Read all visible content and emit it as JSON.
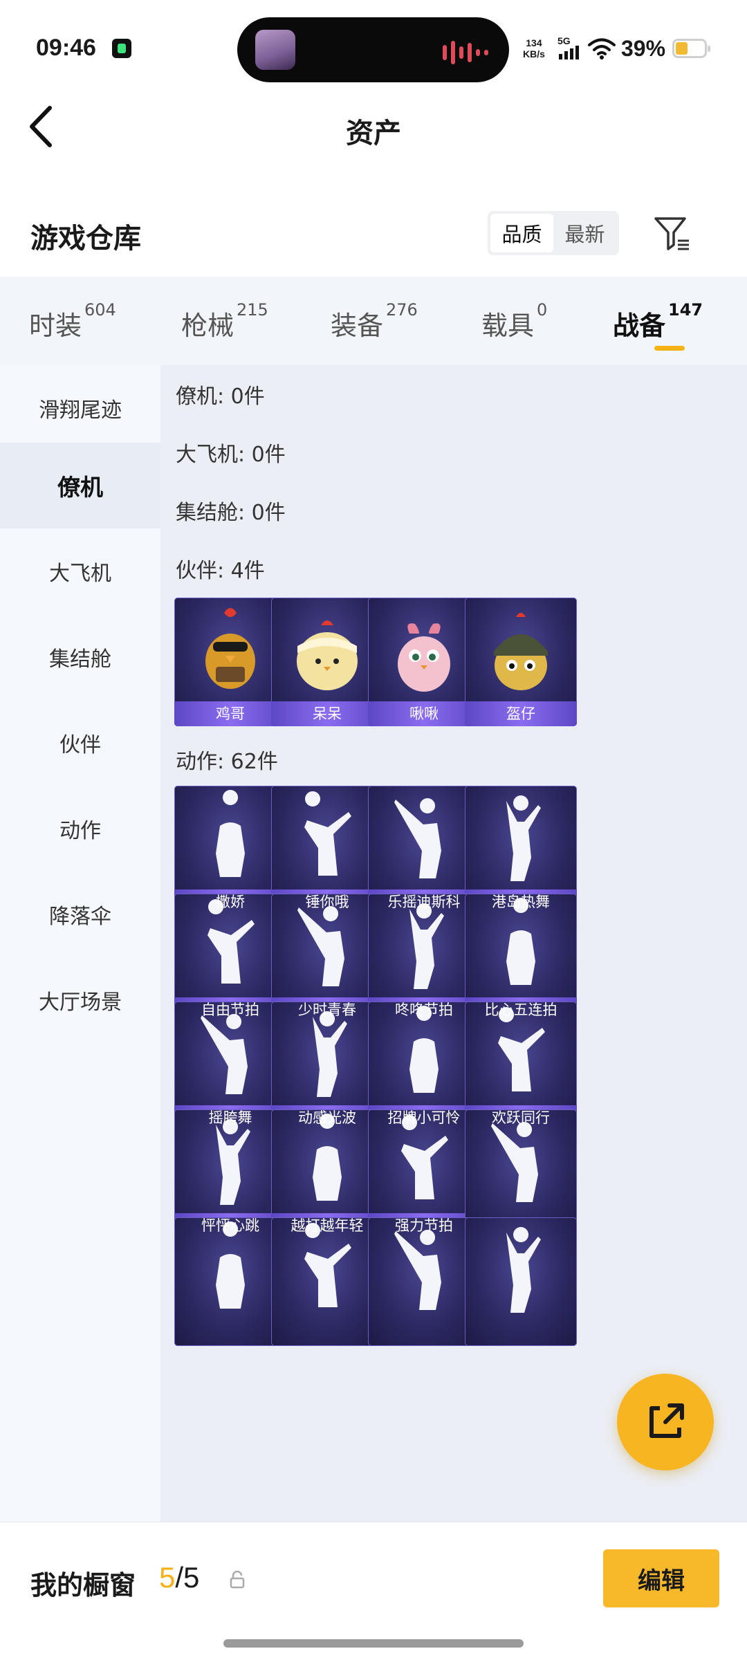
{
  "status_bar": {
    "time": "09:46",
    "net_speed_value": "134",
    "net_speed_unit": "KB/s",
    "network": "5G",
    "battery": "39%"
  },
  "header": {
    "title": "资产"
  },
  "section": {
    "title": "游戏仓库",
    "sort_options": [
      "品质",
      "最新"
    ],
    "active_sort": "品质"
  },
  "tabs": [
    {
      "label": "时装",
      "count": "604"
    },
    {
      "label": "枪械",
      "count": "215"
    },
    {
      "label": "装备",
      "count": "276"
    },
    {
      "label": "载具",
      "count": "0"
    },
    {
      "label": "战备",
      "count": "147"
    }
  ],
  "active_tab": "战备",
  "sidebar": [
    "滑翔尾迹",
    "僚机",
    "大飞机",
    "集结舱",
    "伙伴",
    "动作",
    "降落伞",
    "大厅场景"
  ],
  "active_sidebar": "僚机",
  "categories": {
    "wingman": "僚机: 0件",
    "plane": "大飞机: 0件",
    "capsule": "集结舱: 0件",
    "companion": "伙伴: 4件",
    "emote": "动作: 62件"
  },
  "companions": [
    "鸡哥",
    "呆呆",
    "啾啾",
    "盔仔"
  ],
  "emotes": [
    [
      "撒娇",
      "锤你哦",
      "乐摇迪斯科",
      "港岛热舞"
    ],
    [
      "自由节拍",
      "少时青春",
      "咚咚节拍",
      "比心五连拍"
    ],
    [
      "摇胯舞",
      "动感光波",
      "招牌小可怜",
      "欢跃同行"
    ],
    [
      "怦怦心跳",
      "越打越年轻",
      "强力节拍",
      ""
    ],
    [
      "",
      "",
      "",
      ""
    ]
  ],
  "bottom_bar": {
    "label": "我的橱窗",
    "current": "5",
    "separator": "/",
    "total": "5",
    "edit_button": "编辑"
  },
  "colors": {
    "accent": "#f7b521",
    "card_band": "#7a5ee6",
    "card_bg": "#2b2862"
  }
}
